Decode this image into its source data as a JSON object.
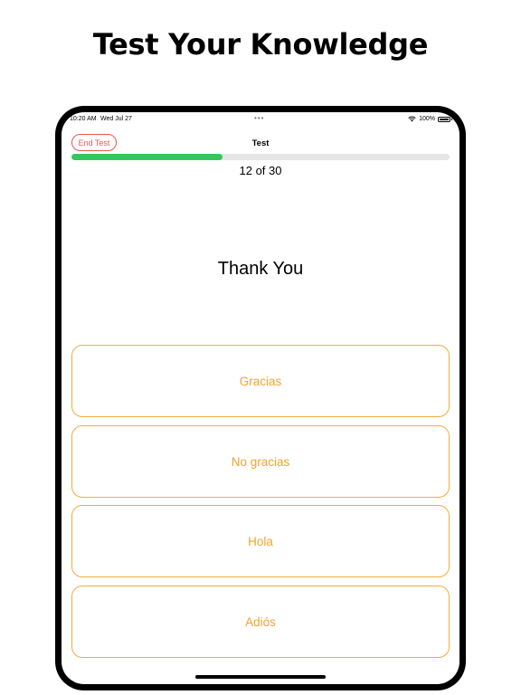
{
  "headline": "Test Your Knowledge",
  "status_bar": {
    "time": "10:20 AM",
    "date": "Wed Jul 27",
    "multitask_dots": "•••",
    "battery": "100%"
  },
  "nav": {
    "end_test_label": "End Test",
    "title": "Test"
  },
  "progress": {
    "current": 12,
    "total": 30,
    "label": "12 of 30",
    "fraction": 0.4
  },
  "question": "Thank You",
  "answers": [
    "Gracias",
    "No gracias",
    "Hola",
    "Adiós"
  ],
  "colors": {
    "end_test": "#e8574f",
    "progress_fill": "#35c759",
    "progress_track": "#e6e6e6",
    "answer_accent": "#f2a32e"
  },
  "icons": {
    "wifi": "wifi-icon",
    "battery": "battery-icon"
  }
}
